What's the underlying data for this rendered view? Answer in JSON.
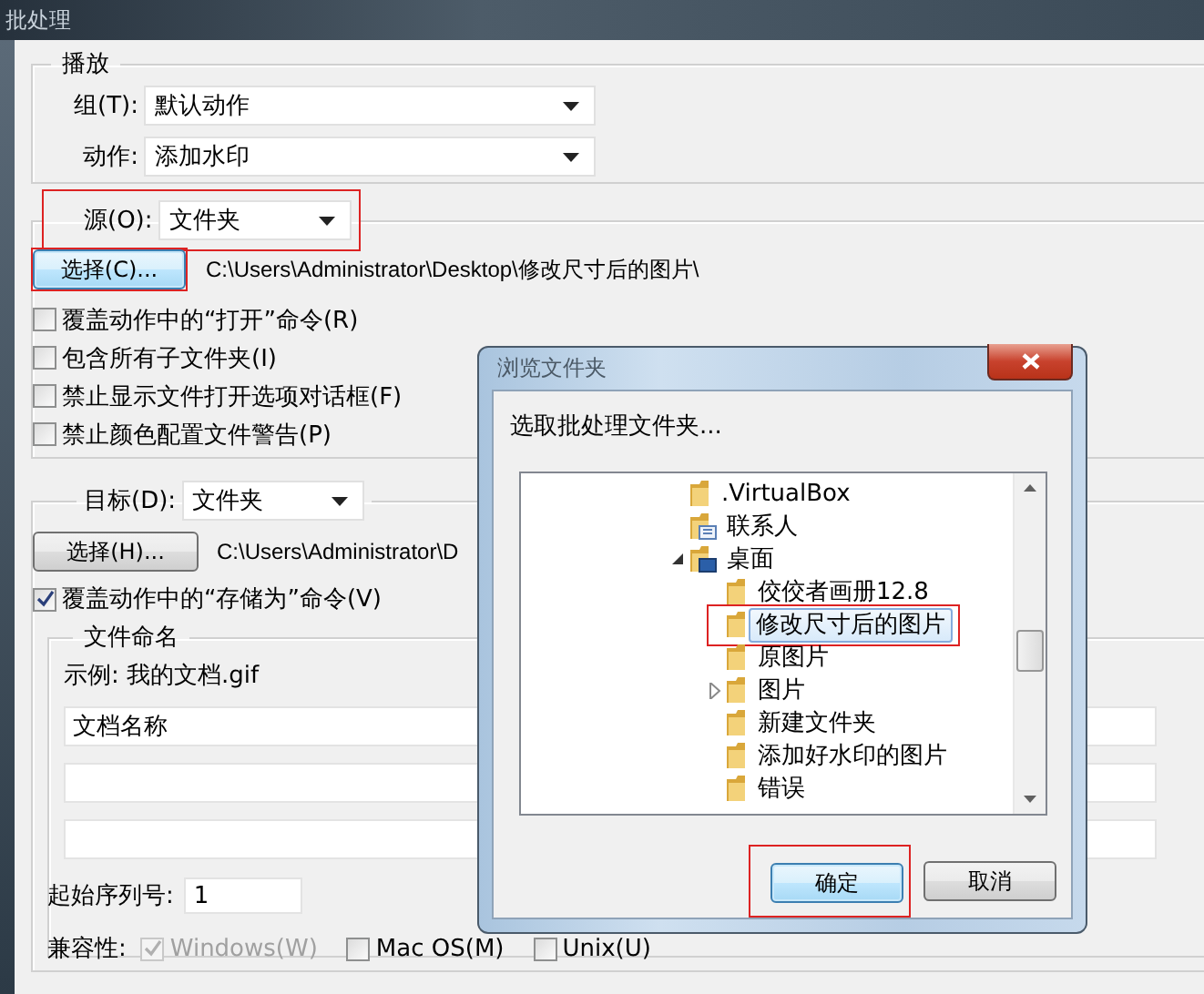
{
  "window": {
    "title": "批处理"
  },
  "play": {
    "legend": "播放",
    "group": {
      "label": "组(T):",
      "value": "默认动作"
    },
    "action": {
      "label": "动作:",
      "value": "添加水印"
    }
  },
  "source": {
    "label": "源(O):",
    "value": "文件夹",
    "highlighted": true,
    "choose_button": {
      "label": "选择(C)...",
      "focused": true,
      "highlighted": true
    },
    "path": "C:\\Users\\Administrator\\Desktop\\修改尺寸后的图片\\",
    "options": [
      {
        "label": "覆盖动作中的“打开”命令(R)",
        "checked": false
      },
      {
        "label": "包含所有子文件夹(I)",
        "checked": false
      },
      {
        "label": "禁止显示文件打开选项对话框(F)",
        "checked": false
      },
      {
        "label": "禁止颜色配置文件警告(P)",
        "checked": false
      }
    ]
  },
  "destination": {
    "label": "目标(D):",
    "value": "文件夹",
    "choose_button": {
      "label": "选择(H)...",
      "focused": false,
      "highlighted": false
    },
    "path": "C:\\Users\\Administrator\\D",
    "override_save": {
      "label": "覆盖动作中的“存储为”命令(V)",
      "checked": true
    },
    "file_naming": {
      "legend": "文件命名",
      "example": "示例: 我的文档.gif",
      "fields": [
        {
          "kind": "text",
          "value": "文档名称"
        },
        {
          "kind": "text"
        },
        {
          "kind": "text"
        }
      ]
    },
    "start_serial": {
      "label": "起始序列号:",
      "value": "1"
    },
    "compatibility": {
      "label": "兼容性:",
      "options": [
        {
          "label": "Windows(W)",
          "checked": true,
          "disabled": true
        },
        {
          "label": "Mac OS(M)",
          "checked": false,
          "disabled": false
        },
        {
          "label": "Unix(U)",
          "checked": false,
          "disabled": false
        }
      ]
    }
  },
  "browse_dialog": {
    "title": "浏览文件夹",
    "prompt": "选取批处理文件夹...",
    "tree": [
      {
        "label": ".VirtualBox",
        "kind": "folder",
        "selected": false,
        "highlighted": false
      },
      {
        "label": "联系人",
        "kind": "contacts",
        "selected": false,
        "highlighted": false
      },
      {
        "label": "桌面",
        "kind": "desktop",
        "expanded": true,
        "selected": false,
        "highlighted": false,
        "children": [
          {
            "label": "佼佼者画册12.8",
            "kind": "folder",
            "selected": false,
            "highlighted": false
          },
          {
            "label": "修改尺寸后的图片",
            "kind": "folder",
            "selected": true,
            "highlighted": true
          },
          {
            "label": "原图片",
            "kind": "folder",
            "selected": false,
            "highlighted": false
          },
          {
            "label": "图片",
            "kind": "folder",
            "expanded": false,
            "selected": false,
            "highlighted": false
          },
          {
            "label": "新建文件夹",
            "kind": "folder",
            "selected": false,
            "highlighted": false
          },
          {
            "label": "添加好水印的图片",
            "kind": "folder",
            "selected": false,
            "highlighted": false
          },
          {
            "label": "错误",
            "kind": "folder",
            "selected": false,
            "highlighted": false
          }
        ]
      }
    ],
    "buttons": [
      {
        "label": "确定",
        "default": true,
        "highlighted": true
      },
      {
        "label": "取消",
        "default": false,
        "highlighted": false
      }
    ]
  }
}
